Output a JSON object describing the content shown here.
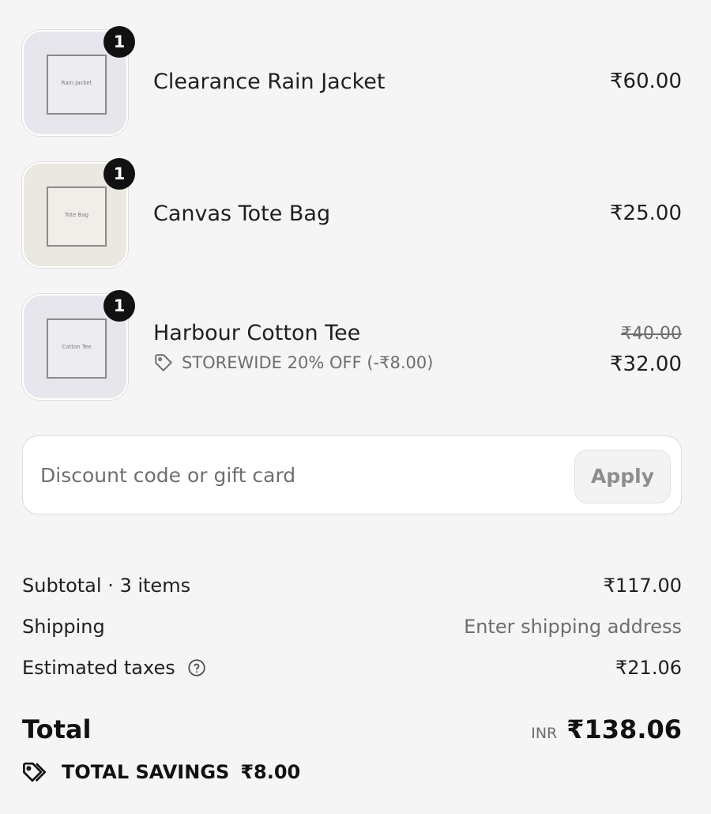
{
  "line_items": [
    {
      "name": "Clearance Rain Jacket",
      "quantity": "1",
      "price": "₹60.00",
      "thumb_caption": "Rain Jacket"
    },
    {
      "name": "Canvas Tote Bag",
      "quantity": "1",
      "price": "₹25.00",
      "thumb_caption": "Tote Bag"
    },
    {
      "name": "Harbour Cotton Tee",
      "quantity": "1",
      "original_price": "₹40.00",
      "price": "₹32.00",
      "discount_label": "STOREWIDE 20% OFF (-₹8.00)",
      "thumb_caption": "Cotton Tee"
    }
  ],
  "discount": {
    "placeholder": "Discount code or gift card",
    "apply_label": "Apply"
  },
  "summary": {
    "subtotal_label": "Subtotal · 3 items",
    "subtotal_value": "₹117.00",
    "shipping_label": "Shipping",
    "shipping_value": "Enter shipping address",
    "taxes_label": "Estimated taxes",
    "taxes_value": "₹21.06",
    "total_label": "Total",
    "total_currency": "INR",
    "total_value": "₹138.06",
    "savings_label": "TOTAL SAVINGS",
    "savings_value": "₹8.00"
  },
  "icons": {
    "tag": "tag-icon",
    "help": "help-circle-icon",
    "savings": "tag-icon"
  },
  "colors": {
    "background": "#f5f5f5",
    "badge": "#111111",
    "muted_text": "#6d6d6d"
  }
}
